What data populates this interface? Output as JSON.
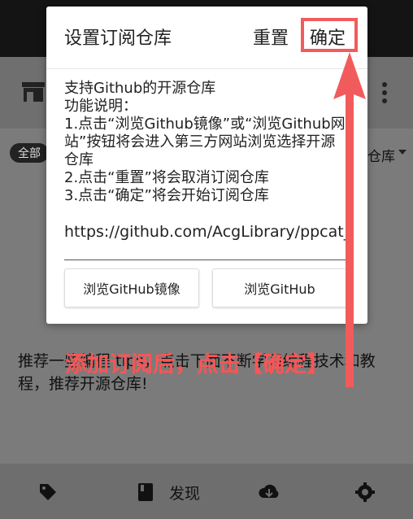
{
  "dialog": {
    "title": "设置订阅仓库",
    "reset_label": "重置",
    "confirm_label": "确定",
    "body_text": "支持Github的开源仓库\n功能说明：\n1.点击“浏览Github镜像”或“浏览Github网站”按钮将会进入第三方网站浏览选择开源仓库\n2.点击“重置”将会取消订阅仓库\n3.点击“确定”将会开始订阅仓库",
    "url_value": "https://github.com/AcgLibrary/ppcat_s",
    "buttons": {
      "mirror_label": "浏览GitHub镜像",
      "site_label": "浏览GitHub"
    }
  },
  "background": {
    "filter_chip": "全部",
    "repo_dropdown": "仓库",
    "text": "推荐一些编程 tips，点击下面不断学习编程技术和教程，推荐开源仓库!",
    "bottom_nav": {
      "discover_label": "发现"
    }
  },
  "annotation": {
    "text": "添加订阅后，点击【确定】",
    "color": "#ff5454"
  },
  "icons": [
    "store-icon",
    "more-vert-icon",
    "tag-icon",
    "book-icon",
    "cloud-download-icon",
    "settings-icon",
    "arrow-up-icon"
  ]
}
